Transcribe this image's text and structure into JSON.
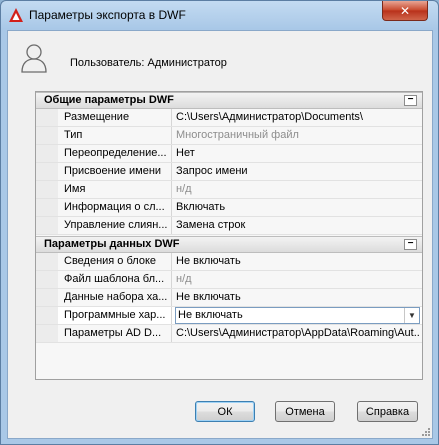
{
  "window": {
    "title": "Параметры экспорта в DWF",
    "close_glyph": "✕"
  },
  "user": {
    "label": "Пользователь: Администратор"
  },
  "sections": [
    {
      "title": "Общие параметры DWF",
      "collapse_glyph": "−",
      "rows": [
        {
          "name": "Размещение",
          "value": "C:\\Users\\Администратор\\Documents\\",
          "disabled": false
        },
        {
          "name": "Тип",
          "value": "Многостраничный файл",
          "disabled": true
        },
        {
          "name": "Переопределение...",
          "value": "Нет",
          "disabled": false
        },
        {
          "name": "Присвоение имени",
          "value": "Запрос имени",
          "disabled": false
        },
        {
          "name": "Имя",
          "value": "н/д",
          "disabled": true
        },
        {
          "name": "Информация о сл...",
          "value": "Включать",
          "disabled": false
        },
        {
          "name": "Управление слиян...",
          "value": "Замена строк",
          "disabled": false
        }
      ]
    },
    {
      "title": "Параметры данных DWF",
      "collapse_glyph": "−",
      "rows": [
        {
          "name": "Сведения о блоке",
          "value": "Не включать",
          "disabled": false
        },
        {
          "name": "Файл шаблона бл...",
          "value": "н/д",
          "disabled": true
        },
        {
          "name": "Данные набора ха...",
          "value": "Не включать",
          "disabled": false
        },
        {
          "name": "Программные хар...",
          "value": "Не включать",
          "disabled": false,
          "selected": true
        },
        {
          "name": "Параметры AD D...",
          "value": "C:\\Users\\Администратор\\AppData\\Roaming\\Aut...",
          "disabled": false
        }
      ]
    }
  ],
  "buttons": {
    "ok": "ОК",
    "cancel": "Отмена",
    "help": "Справка"
  },
  "icons": {
    "app": "autocad-logo-icon",
    "user": "user-silhouette-icon",
    "dropdown": "chevron-down-icon"
  },
  "colors": {
    "title_bar": "#a9c8e7",
    "close_button": "#c7462a",
    "app_icon": "#d2201a"
  }
}
